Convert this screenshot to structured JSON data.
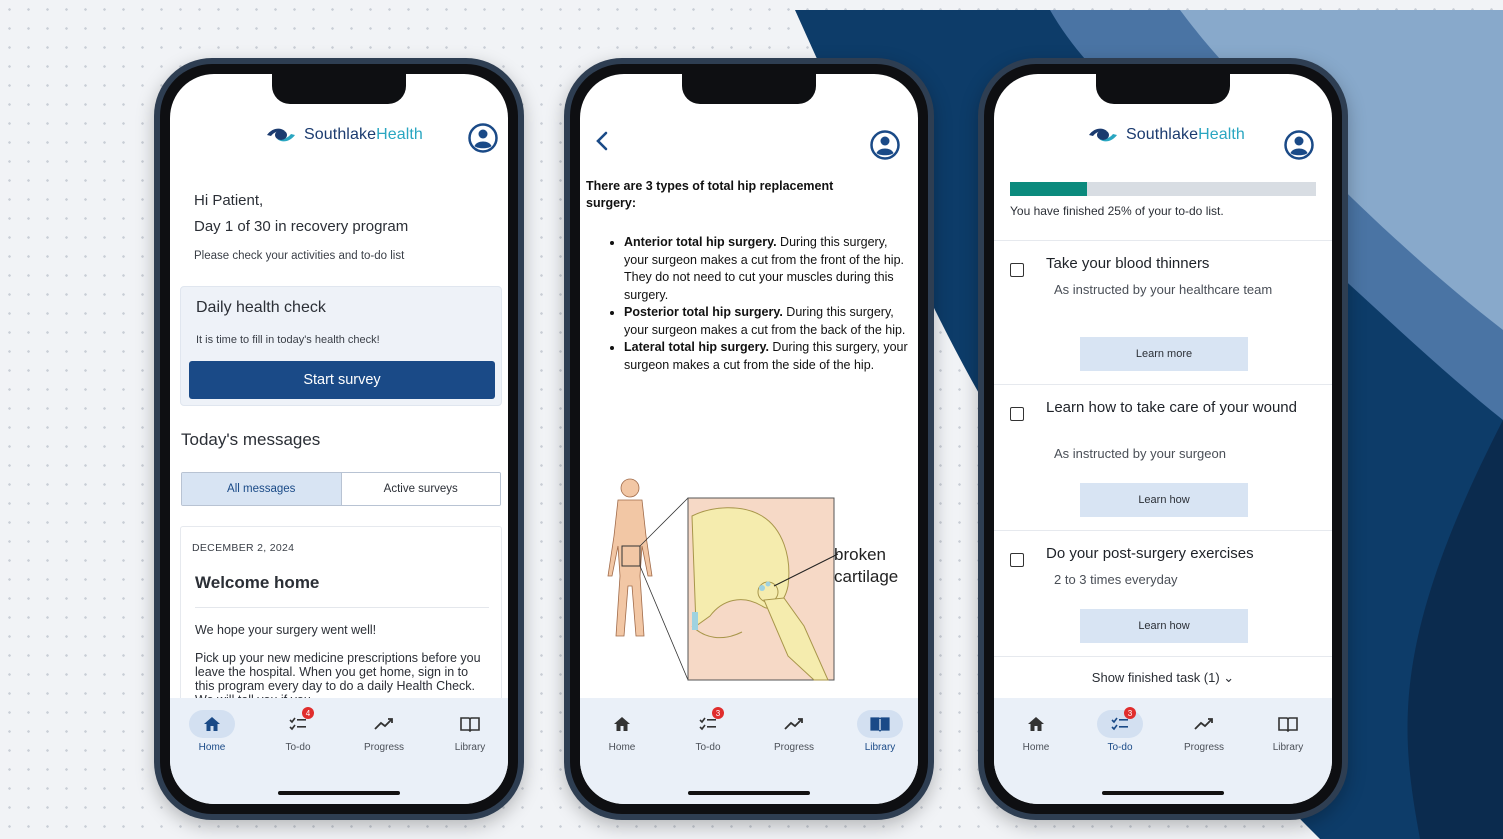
{
  "colors": {
    "brand_navy": "#1a4a87",
    "brand_teal": "#2aa6c1",
    "progress": "#0b8a7d",
    "badge": "#e02d2d"
  },
  "brand": {
    "name_part1": "Southlake",
    "name_part2": "Health"
  },
  "nav": {
    "home": "Home",
    "todo": "To-do",
    "progress": "Progress",
    "library": "Library",
    "todo_badge": "4",
    "todo_badge_alt": "3"
  },
  "phone1": {
    "greeting": "Hi Patient,",
    "day": "Day 1 of 30 in recovery program",
    "instruction": "Please check your activities and to-do list",
    "health_check": {
      "title": "Daily health check",
      "subtitle": "It is time to fill in today's health check!",
      "button": "Start survey"
    },
    "messages_title": "Today's messages",
    "tabs": {
      "all": "All messages",
      "active": "Active surveys"
    },
    "message": {
      "date": "DECEMBER 2, 2024",
      "title": "Welcome home",
      "line1": "We hope your surgery went well!",
      "line2": "Pick up your new medicine prescriptions before you leave the hospital. When you get home, sign in to this program every day to do a daily Health Check. We will tell you if you"
    }
  },
  "phone2": {
    "intro": "There are 3 types of total hip replacement surgery:",
    "items": [
      {
        "bold": "Anterior total hip surgery.",
        "text": " During this surgery, your surgeon makes a cut from the front of the hip. They do not need to cut your muscles during this surgery."
      },
      {
        "bold": "Posterior total hip surgery.",
        "text": " During this surgery, your surgeon makes a cut from the back of the hip."
      },
      {
        "bold": "Lateral total hip surgery.",
        "text": " During this surgery, your surgeon makes a cut from the side of the hip."
      }
    ],
    "figure_label_1": "broken",
    "figure_label_2": "cartilage"
  },
  "phone3": {
    "progress_fraction": 0.25,
    "progress_text": "You have finished 25% of your to-do list.",
    "todos": [
      {
        "title": "Take your blood thinners",
        "subtitle": "As instructed by your healthcare team",
        "button": "Learn more"
      },
      {
        "title": "Learn how to take care of your wound",
        "subtitle": "As instructed by your surgeon",
        "button": "Learn how"
      },
      {
        "title": "Do your post-surgery exercises",
        "subtitle": "2 to 3 times everyday",
        "button": "Learn how"
      }
    ],
    "show_finished": "Show finished task (1) ⌄"
  }
}
